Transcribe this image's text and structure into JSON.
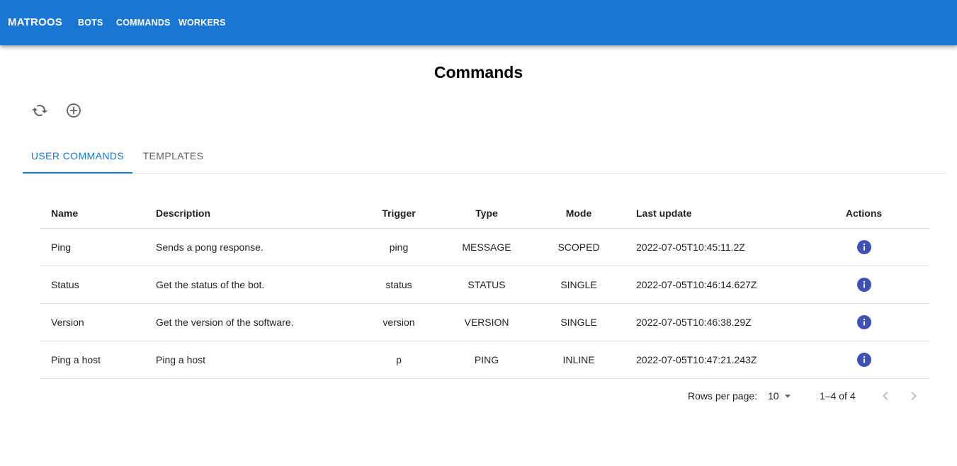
{
  "appbar": {
    "brand": "MATROOS",
    "nav": [
      "BOTS",
      "COMMANDS",
      "WORKERS"
    ],
    "color": "#1976d2"
  },
  "page": {
    "title": "Commands",
    "toolbar": {
      "refresh_icon": "refresh-icon",
      "add_icon": "add-circle-icon"
    }
  },
  "tabs": [
    {
      "label": "USER COMMANDS",
      "active": true
    },
    {
      "label": "TEMPLATES",
      "active": false
    }
  ],
  "table": {
    "headers": [
      "Name",
      "Description",
      "Trigger",
      "Type",
      "Mode",
      "Last update",
      "Actions"
    ],
    "rows": [
      {
        "name": "Ping",
        "description": "Sends a pong response.",
        "trigger": "ping",
        "type": "MESSAGE",
        "mode": "SCOPED",
        "last_update": "2022-07-05T10:45:11.2Z",
        "action_icon": "info-icon"
      },
      {
        "name": "Status",
        "description": "Get the status of the bot.",
        "trigger": "status",
        "type": "STATUS",
        "mode": "SINGLE",
        "last_update": "2022-07-05T10:46:14.627Z",
        "action_icon": "info-icon"
      },
      {
        "name": "Version",
        "description": "Get the version of the software.",
        "trigger": "version",
        "type": "VERSION",
        "mode": "SINGLE",
        "last_update": "2022-07-05T10:46:38.29Z",
        "action_icon": "info-icon"
      },
      {
        "name": "Ping a host",
        "description": "Ping a host",
        "trigger": "p",
        "type": "PING",
        "mode": "INLINE",
        "last_update": "2022-07-05T10:47:21.243Z",
        "action_icon": "info-icon"
      }
    ]
  },
  "pagination": {
    "rows_per_page_label": "Rows per page:",
    "rows_per_page": "10",
    "range": "1–4 of 4"
  },
  "colors": {
    "accent": "#1976d2",
    "info": "#3f51b5",
    "divider": "#e0e0e0"
  }
}
